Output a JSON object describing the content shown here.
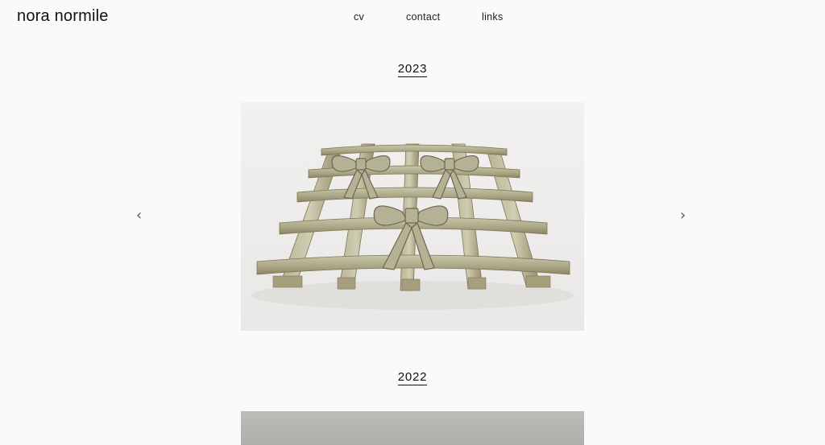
{
  "header": {
    "logo": "nora normile",
    "nav": [
      {
        "label": "cv"
      },
      {
        "label": "contact"
      },
      {
        "label": "links"
      }
    ]
  },
  "gallery": [
    {
      "year": "2023",
      "image": "ceramic lattice sculpture with three bows"
    },
    {
      "year": "2022",
      "image": "grey photograph (partially visible)"
    }
  ],
  "controls": {
    "prev": "‹",
    "next": "›"
  }
}
